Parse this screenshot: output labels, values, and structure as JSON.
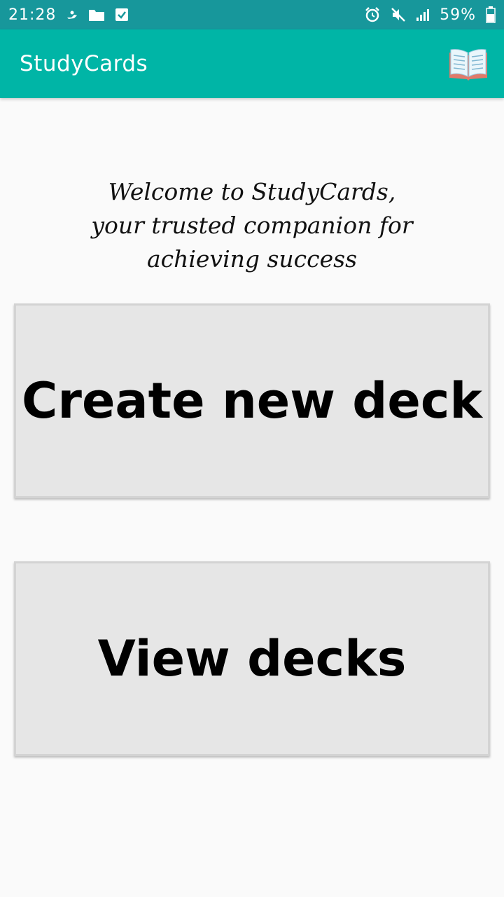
{
  "status_bar": {
    "time": "21:28",
    "battery_text": "59%",
    "icons_left": [
      "hand-icon",
      "folder-icon",
      "checkbox-icon"
    ],
    "icons_right": [
      "alarm-icon",
      "mute-icon",
      "signal-icon",
      "battery-icon"
    ],
    "bar_color": "#17979b"
  },
  "app_bar": {
    "title": "StudyCards",
    "icon": "open-book-icon",
    "color": "#00b5a6"
  },
  "welcome": {
    "line1": "Welcome to StudyCards,",
    "line2": "your trusted companion for",
    "line3": "achieving success"
  },
  "buttons": {
    "create_label": "Create new deck",
    "view_label": "View decks"
  }
}
